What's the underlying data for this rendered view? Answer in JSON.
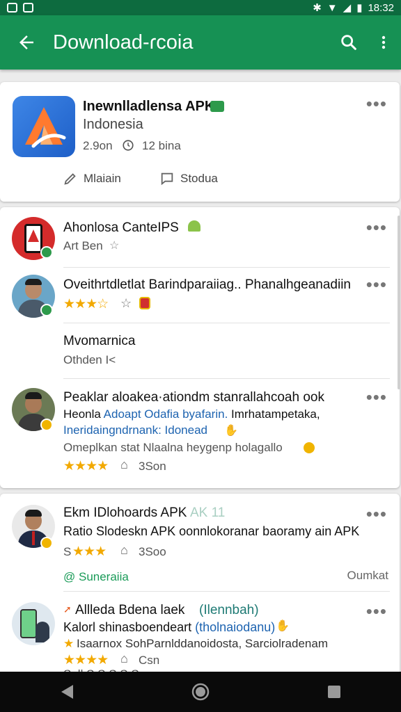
{
  "status": {
    "time": "18:32"
  },
  "appbar": {
    "title": "Download-ɾcoia"
  },
  "featured": {
    "name": "Inewnlladlensa APK",
    "subtitle": "Indonesia",
    "meta_size": "2.9on",
    "meta_time": "12 bina",
    "action_left": "Mlaiain",
    "action_right": "Stodua"
  },
  "section1": {
    "items": [
      {
        "title": "Ahonlosa CanteIPS",
        "sub": "Art Ben"
      },
      {
        "title": "Oveithrtdletlat Barindparaiiag.. Phanalhgeanadiin",
        "stars": "★★★☆"
      },
      {
        "title": "Mvomarnica",
        "sub": "Othden I<"
      },
      {
        "line1": "Peaklar aloakea·ationdm stanrallahcoah ook",
        "line2a": "Heonla",
        "line2b": "Adoapt Odafia byafarin.",
        "line2c": "Imrhatampetaka,",
        "line3": "Ineridaingndrnank: Idonead",
        "line4": "Omeplkan stat Nlaalna heygenp holagallo",
        "stars": "★★★★",
        "size": "3Son"
      }
    ]
  },
  "section2": {
    "item1": {
      "title": "Ekm IDlohoards APK",
      "tag": "AK 11",
      "desc": "Ratio Slodeskn APK oonnlokoranar baoramy ain APK",
      "rating_prefix": "S",
      "stars": "★★★",
      "size": "3Soo"
    },
    "link_left": "@ Suneraiia",
    "link_right": "Oumkat",
    "item2": {
      "title": "Allleda Bdena laek",
      "tag": "(Ilennbah)",
      "line2a": "Kalorl shinasboendeart",
      "line2b": "(tholnaiodanu)",
      "line3": "Isaarnox SohParnlddanoidosta, Sarciolradenam",
      "stars": "★★★★",
      "size": "Csn",
      "cut": "Sull S.S.S.S.S"
    }
  }
}
